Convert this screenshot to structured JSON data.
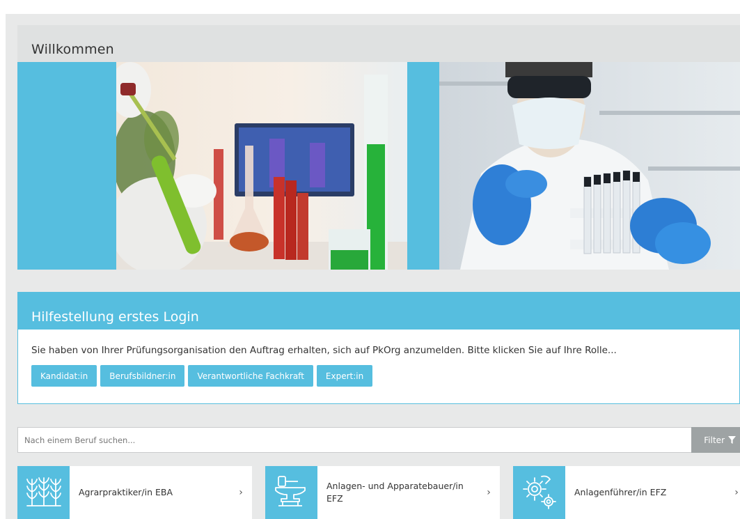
{
  "welcome": {
    "title": "Willkommen"
  },
  "help": {
    "title": "Hilfestellung erstes Login",
    "text": "Sie haben von Ihrer Prüfungsorganisation den Auftrag erhalten, sich auf PkOrg anzumelden. Bitte klicken Sie auf Ihre Rolle...",
    "roles": [
      "Kandidat:in",
      "Berufsbildner:in",
      "Verantwortliche Fachkraft",
      "Expert:in"
    ]
  },
  "search": {
    "placeholder": "Nach einem Beruf suchen...",
    "filter_label": "Filter"
  },
  "professions": [
    {
      "label": "Agrarpraktiker/in EBA",
      "icon": "wheat-icon",
      "chevron": "›"
    },
    {
      "label": "Anlagen- und Apparatebauer/in EFZ",
      "icon": "anvil-icon",
      "chevron": "›"
    },
    {
      "label": "Anlagenführer/in EFZ",
      "icon": "gears-icon",
      "chevron": "›"
    }
  ],
  "colors": {
    "accent": "#56bedf",
    "page_bg": "#e8e9e9",
    "filter_bg": "#9ea3a4"
  }
}
